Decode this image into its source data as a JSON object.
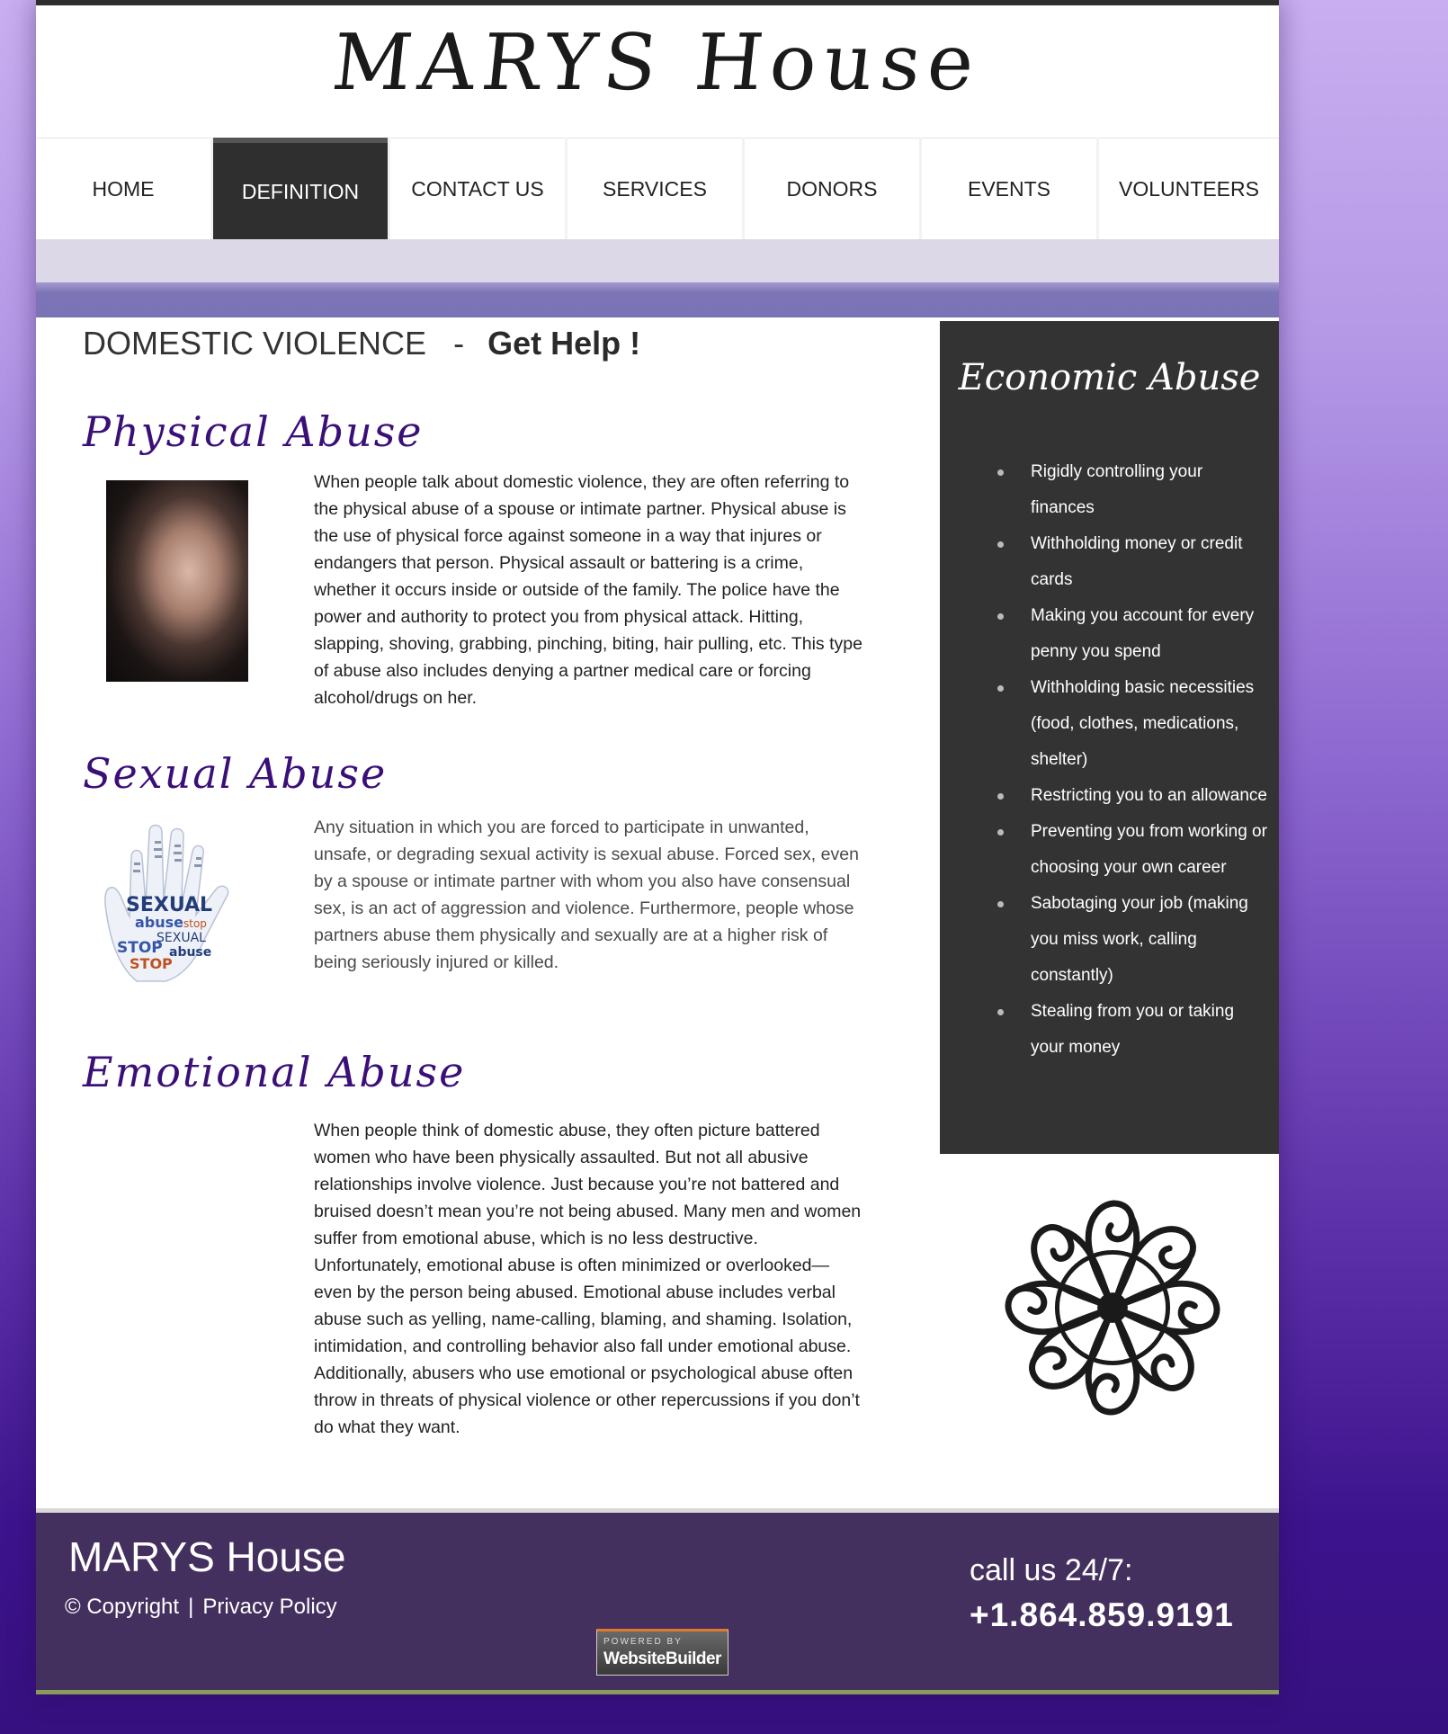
{
  "site": {
    "logo_text": "MARYS House"
  },
  "nav": {
    "items": [
      {
        "label": "HOME"
      },
      {
        "label": "DEFINITION"
      },
      {
        "label": "CONTACT US"
      },
      {
        "label": "SERVICES"
      },
      {
        "label": "DONORS"
      },
      {
        "label": "EVENTS"
      },
      {
        "label": "VOLUNTEERS"
      }
    ],
    "active": "DEFINITION"
  },
  "main": {
    "title_left": "DOMESTIC VIOLENCE",
    "title_sep": "-",
    "title_right": "Get Help !",
    "sections": [
      {
        "heading": "Physical Abuse",
        "text": "When people talk about domestic violence, they are often referring to the physical abuse of a spouse or intimate partner. Physical abuse is the use of physical force against someone in a way that injures or endangers that person. Physical assault or battering is a crime, whether it occurs inside or outside of the family. The police have the power and authority to protect you from physical attack. Hitting, slapping, shoving, grabbing, pinching, biting, hair pulling, etc. This type of abuse also includes denying a partner medical care or forcing alcohol/drugs on her."
      },
      {
        "heading": "Sexual Abuse",
        "text": "Any situation in which you are forced to participate in unwanted, unsafe, or degrading sexual activity is sexual abuse. Forced sex, even by a spouse or intimate partner with whom you also have consensual sex, is an act of aggression and violence. Furthermore, people whose partners abuse them physically and sexually are at a higher risk of being seriously injured or killed."
      },
      {
        "heading": "Emotional Abuse",
        "text": "When people think of domestic abuse, they often picture battered women who have been physically assaulted. But not all abusive relationships involve violence. Just because you’re not battered and bruised doesn’t mean you’re not being abused. Many men and women suffer from emotional abuse, which is no less destructive. Unfortunately, emotional abuse is often minimized or overlooked—even by the person being abused. Emotional abuse includes verbal abuse such as yelling, name-calling, blaming, and shaming. Isolation, intimidation, and controlling behavior also fall under emotional abuse. Additionally, abusers who use emotional or psychological abuse often throw in threats of physical violence or other repercussions if you don’t do what they want."
      }
    ],
    "hand_graphic_words": [
      "SEXUAL",
      "abuse",
      "stop",
      "SEXUAL",
      "STOP",
      "abuse",
      "STOP"
    ]
  },
  "sidebar": {
    "heading": "Economic Abuse",
    "items": [
      "Rigidly controlling your finances",
      "Withholding money or credit cards",
      "Making you account for every penny you spend",
      "Withholding basic necessities (food, clothes, medications, shelter)",
      "Restricting you to an allowance",
      "Preventing you from working or choosing your own career",
      "Sabotaging your job (making you miss work, calling constantly)",
      "Stealing from you or taking your money"
    ]
  },
  "footer": {
    "brand": "MARYS House",
    "copyright": "© Copyright",
    "divider": "|",
    "privacy": "Privacy Policy",
    "call_label": "call us 24/7:",
    "phone": "+1.864.859.9191",
    "badge_top": "POWERED BY",
    "badge_main": "WebsiteBuilder"
  },
  "colors": {
    "accent_purple": "#3a0f78",
    "nav_active_bg": "#2f2f2f",
    "sidebar_bg": "#333333",
    "footer_bg": "#44305e",
    "band_purple": "#7a73b5"
  },
  "icons": {
    "ornament": "scroll-ornament-icon",
    "hand": "hand-word-cloud-graphic"
  }
}
